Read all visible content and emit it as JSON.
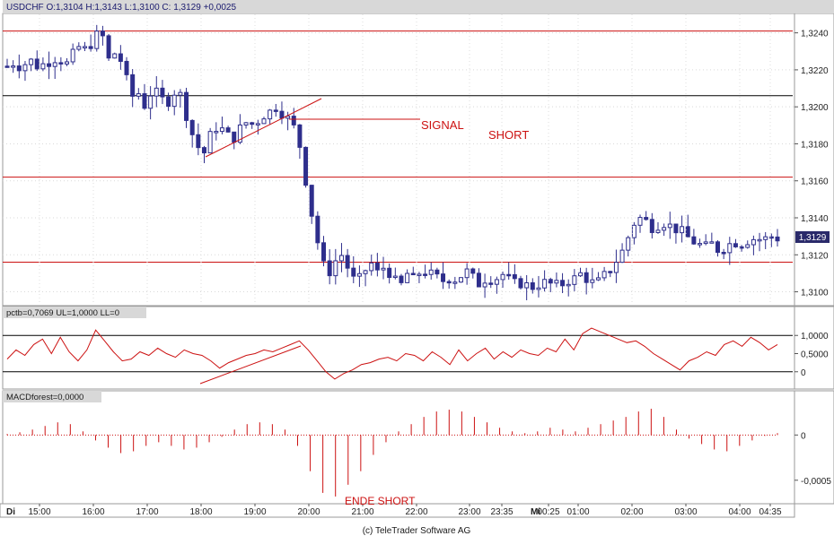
{
  "header": {
    "symbol_quote": "USDCHF O:1,3104 H:1,3143 L:1,3100 C: 1,3129 +0,0025"
  },
  "indicators": {
    "pctb_label": "pctb=0,7069 UL=1,0000 LL=0",
    "macd_label": "MACDforest=0,0000"
  },
  "annotations": {
    "signal": "SIGNAL",
    "short": "SHORT",
    "ende_short": "ENDE SHORT"
  },
  "last_price_tag": "1,3129",
  "copyright": "(c) TeleTrader Software AG",
  "colors": {
    "candle": "#2e2e8c",
    "indicator": "#cc1111",
    "annotation": "#cc1111",
    "frame_grey": "#b8b8b8"
  },
  "chart_data": [
    {
      "type": "candlestick",
      "title": "USDCHF O:1,3104 H:1,3143 L:1,3100 C: 1,3129 +0,0025",
      "ylim": [
        1.3093,
        1.325
      ],
      "yticks": [
        "1,3240",
        "1,3220",
        "1,3200",
        "1,3180",
        "1,3160",
        "1,3140",
        "1,3120",
        "1,3100"
      ],
      "ytick_values": [
        1.324,
        1.322,
        1.32,
        1.318,
        1.316,
        1.314,
        1.312,
        1.31
      ],
      "xticks": [
        "Di",
        "15:00",
        "16:00",
        "17:00",
        "18:00",
        "19:00",
        "20:00",
        "21:00",
        "22:00",
        "23:00",
        "23:35",
        "Mi",
        "00:25",
        "01:00",
        "02:00",
        "03:00",
        "04:00",
        "04:35"
      ],
      "horizontal_levels": [
        {
          "value": 1.3241,
          "color": "#cc1111"
        },
        {
          "value": 1.3206,
          "color": "#000000"
        },
        {
          "value": 1.3162,
          "color": "#cc1111"
        },
        {
          "value": 1.3116,
          "color": "#cc1111"
        }
      ],
      "close_path": [
        1.3222,
        1.3224,
        1.3221,
        1.3226,
        1.3222,
        1.3223,
        1.3225,
        1.3227,
        1.3222,
        1.3228,
        1.3233,
        1.323,
        1.3238,
        1.324,
        1.3225,
        1.323,
        1.3222,
        1.3205,
        1.3208,
        1.32,
        1.321,
        1.3205,
        1.3202,
        1.3208,
        1.3206,
        1.319,
        1.318,
        1.3174,
        1.3185,
        1.319,
        1.3186,
        1.3182,
        1.3188,
        1.3192,
        1.319,
        1.3195,
        1.3197,
        1.32,
        1.3196,
        1.3192,
        1.3185,
        1.3162,
        1.314,
        1.3122,
        1.3108,
        1.3116,
        1.312,
        1.3112,
        1.3104,
        1.311,
        1.3116,
        1.311,
        1.3114,
        1.3108,
        1.3102,
        1.311,
        1.3106,
        1.3112,
        1.311,
        1.3108,
        1.3106,
        1.3108,
        1.3106,
        1.3112,
        1.3108,
        1.3104,
        1.3108,
        1.3106,
        1.311,
        1.3107,
        1.3104,
        1.3105,
        1.3102,
        1.3104,
        1.3105,
        1.3104,
        1.3103,
        1.3106,
        1.3107,
        1.311,
        1.3106,
        1.3104,
        1.3108,
        1.3112,
        1.3118,
        1.3124,
        1.3136,
        1.314,
        1.3138,
        1.3134,
        1.3138,
        1.3136,
        1.3134,
        1.3132,
        1.3128,
        1.3126,
        1.3124,
        1.3126,
        1.3122,
        1.3125,
        1.3127,
        1.3126,
        1.3128,
        1.3129,
        1.3128,
        1.313,
        1.3129
      ]
    },
    {
      "type": "line",
      "title": "pctb=0,7069 UL=1,0000 LL=0",
      "ylim": [
        -0.45,
        1.45
      ],
      "yticks": [
        "1,0000",
        "0,5000",
        "0"
      ],
      "ytick_values": [
        1.0,
        0.5,
        0.0
      ],
      "levels": [
        1.0,
        0.0
      ],
      "values": [
        0.35,
        0.6,
        0.45,
        0.75,
        0.9,
        0.5,
        0.95,
        0.55,
        0.3,
        0.6,
        1.15,
        0.85,
        0.55,
        0.3,
        0.35,
        0.55,
        0.45,
        0.65,
        0.5,
        0.4,
        0.6,
        0.5,
        0.45,
        0.3,
        0.1,
        0.25,
        0.35,
        0.45,
        0.5,
        0.6,
        0.55,
        0.65,
        0.75,
        0.85,
        0.6,
        0.3,
        0.0,
        -0.2,
        -0.05,
        0.05,
        0.2,
        0.25,
        0.35,
        0.4,
        0.3,
        0.5,
        0.45,
        0.3,
        0.55,
        0.4,
        0.2,
        0.6,
        0.3,
        0.5,
        0.65,
        0.35,
        0.55,
        0.4,
        0.6,
        0.5,
        0.45,
        0.65,
        0.55,
        0.9,
        0.6,
        1.05,
        1.2,
        1.1,
        1.0,
        0.9,
        0.8,
        0.85,
        0.7,
        0.5,
        0.35,
        0.2,
        0.05,
        0.3,
        0.4,
        0.55,
        0.45,
        0.75,
        0.85,
        0.7,
        0.95,
        0.8,
        0.6,
        0.75
      ]
    },
    {
      "type": "bar",
      "title": "MACDforest=0,0000",
      "ylim": [
        -0.00075,
        0.00035
      ],
      "yticks": [
        "0",
        "-0,0005"
      ],
      "ytick_values": [
        0.0,
        -0.0005
      ],
      "values": [
        1e-05,
        3e-05,
        6e-05,
        0.0001,
        0.00014,
        0.00012,
        4e-05,
        -6e-05,
        -0.00014,
        -0.0002,
        -0.00018,
        -0.00012,
        -8e-05,
        -0.00012,
        -0.00016,
        -0.00014,
        -8e-05,
        -2e-05,
        6e-05,
        0.00012,
        0.00014,
        0.00012,
        6e-05,
        -0.00012,
        -0.0004,
        -0.00064,
        -0.00068,
        -0.00055,
        -0.0004,
        -0.00022,
        -8e-05,
        4e-05,
        0.00012,
        0.0002,
        0.00026,
        0.00028,
        0.00026,
        0.0002,
        0.00014,
        8e-05,
        4e-05,
        2e-05,
        4e-05,
        8e-05,
        6e-05,
        4e-05,
        8e-05,
        0.00012,
        0.00016,
        0.0002,
        0.00026,
        0.00029,
        0.0002,
        6e-05,
        -4e-05,
        -0.0001,
        -0.00016,
        -0.00018,
        -0.00012,
        -6e-05,
        -1e-05,
        2e-05
      ]
    }
  ]
}
